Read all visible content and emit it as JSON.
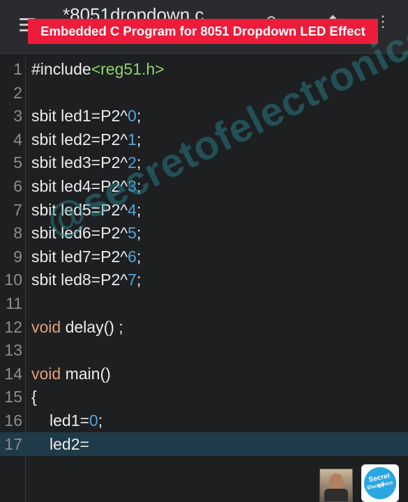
{
  "appbar": {
    "file_title": "*8051dropdown.c",
    "file_subtitle": "",
    "banner": "Embedded C Program for 8051 Dropdown LED Effect"
  },
  "watermark": "@secretofelectronics",
  "editor": {
    "lines": [
      {
        "n": "1",
        "tokens": [
          {
            "t": "#include",
            "c": "txt"
          },
          {
            "t": "<reg51.h>",
            "c": "str"
          }
        ]
      },
      {
        "n": "2",
        "tokens": []
      },
      {
        "n": "3",
        "tokens": [
          {
            "t": "sbit led1=P2^",
            "c": "txt"
          },
          {
            "t": "0",
            "c": "num"
          },
          {
            "t": ";",
            "c": "txt"
          }
        ]
      },
      {
        "n": "4",
        "tokens": [
          {
            "t": "sbit led2=P2^",
            "c": "txt"
          },
          {
            "t": "1",
            "c": "num"
          },
          {
            "t": ";",
            "c": "txt"
          }
        ]
      },
      {
        "n": "5",
        "tokens": [
          {
            "t": "sbit led3=P2^",
            "c": "txt"
          },
          {
            "t": "2",
            "c": "num"
          },
          {
            "t": ";",
            "c": "txt"
          }
        ]
      },
      {
        "n": "6",
        "tokens": [
          {
            "t": "sbit led4=P2^",
            "c": "txt"
          },
          {
            "t": "3",
            "c": "num"
          },
          {
            "t": ";",
            "c": "txt"
          }
        ]
      },
      {
        "n": "7",
        "tokens": [
          {
            "t": "sbit led5=P2^",
            "c": "txt"
          },
          {
            "t": "4",
            "c": "num"
          },
          {
            "t": ";",
            "c": "txt"
          }
        ]
      },
      {
        "n": "8",
        "tokens": [
          {
            "t": "sbit led6=P2^",
            "c": "txt"
          },
          {
            "t": "5",
            "c": "num"
          },
          {
            "t": ";",
            "c": "txt"
          }
        ]
      },
      {
        "n": "9",
        "tokens": [
          {
            "t": "sbit led7=P2^",
            "c": "txt"
          },
          {
            "t": "6",
            "c": "num"
          },
          {
            "t": ";",
            "c": "txt"
          }
        ]
      },
      {
        "n": "10",
        "tokens": [
          {
            "t": "sbit led8=P2^",
            "c": "txt"
          },
          {
            "t": "7",
            "c": "num"
          },
          {
            "t": ";",
            "c": "txt"
          }
        ]
      },
      {
        "n": "11",
        "tokens": []
      },
      {
        "n": "12",
        "tokens": [
          {
            "t": "void",
            "c": "kw"
          },
          {
            "t": " delay() ;",
            "c": "txt"
          }
        ]
      },
      {
        "n": "13",
        "tokens": []
      },
      {
        "n": "14",
        "tokens": [
          {
            "t": "void",
            "c": "kw"
          },
          {
            "t": " main()",
            "c": "txt"
          }
        ]
      },
      {
        "n": "15",
        "tokens": [
          {
            "t": "{",
            "c": "txt"
          }
        ]
      },
      {
        "n": "16",
        "indent": true,
        "tokens": [
          {
            "t": "led1=",
            "c": "txt"
          },
          {
            "t": "0",
            "c": "num"
          },
          {
            "t": ";",
            "c": "txt"
          }
        ]
      },
      {
        "n": "17",
        "indent": true,
        "current": true,
        "tokens": [
          {
            "t": "led2=",
            "c": "txt"
          }
        ]
      }
    ]
  },
  "colors": {
    "keyword": "#e0a07a",
    "number": "#4fa6e0",
    "string": "#8fd46a",
    "banner": "#ee1c3b",
    "current_line": "#1f3a48"
  },
  "icons": [
    "menu-icon",
    "undo-icon",
    "save-icon",
    "more-icon"
  ],
  "logo": {
    "line1": "Secret of",
    "line2": "Electronics"
  }
}
